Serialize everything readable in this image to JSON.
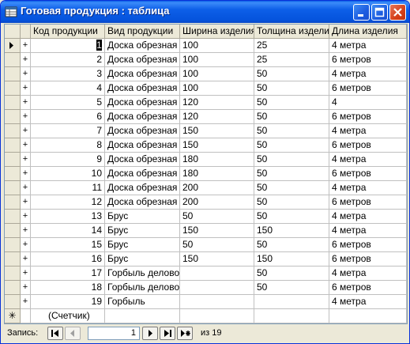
{
  "window": {
    "title": "Готовая продукция : таблица"
  },
  "columns": [
    "Код продукции",
    "Вид продукции",
    "Ширина изделия",
    "Толщина изделия",
    "Длина изделия"
  ],
  "rows": [
    {
      "id": "1",
      "type": "Доска обрезная",
      "width": "100",
      "thickness": "25",
      "length": "4 метра"
    },
    {
      "id": "2",
      "type": "Доска обрезная",
      "width": "100",
      "thickness": "25",
      "length": "6 метров"
    },
    {
      "id": "3",
      "type": "Доска обрезная",
      "width": "100",
      "thickness": "50",
      "length": "4 метра"
    },
    {
      "id": "4",
      "type": "Доска обрезная",
      "width": "100",
      "thickness": "50",
      "length": "6 метров"
    },
    {
      "id": "5",
      "type": "Доска обрезная",
      "width": "120",
      "thickness": "50",
      "length": "4"
    },
    {
      "id": "6",
      "type": "Доска обрезная",
      "width": "120",
      "thickness": "50",
      "length": "6 метров"
    },
    {
      "id": "7",
      "type": "Доска обрезная",
      "width": "150",
      "thickness": "50",
      "length": "4 метра"
    },
    {
      "id": "8",
      "type": "Доска обрезная",
      "width": "150",
      "thickness": "50",
      "length": "6 метров"
    },
    {
      "id": "9",
      "type": "Доска обрезная",
      "width": "180",
      "thickness": "50",
      "length": "4 метра"
    },
    {
      "id": "10",
      "type": "Доска обрезная",
      "width": "180",
      "thickness": "50",
      "length": "6 метров"
    },
    {
      "id": "11",
      "type": "Доска обрезная",
      "width": "200",
      "thickness": "50",
      "length": "4 метра"
    },
    {
      "id": "12",
      "type": "Доска обрезная",
      "width": "200",
      "thickness": "50",
      "length": "6 метров"
    },
    {
      "id": "13",
      "type": "Брус",
      "width": "50",
      "thickness": "50",
      "length": "4 метра"
    },
    {
      "id": "14",
      "type": "Брус",
      "width": "150",
      "thickness": "150",
      "length": "4 метра"
    },
    {
      "id": "15",
      "type": "Брус",
      "width": "50",
      "thickness": "50",
      "length": "6 метров"
    },
    {
      "id": "16",
      "type": "Брус",
      "width": "150",
      "thickness": "150",
      "length": "6 метров"
    },
    {
      "id": "17",
      "type": "Горбыль деловой",
      "width": "",
      "thickness": "50",
      "length": "4 метра"
    },
    {
      "id": "18",
      "type": "Горбыль деловой",
      "width": "",
      "thickness": "50",
      "length": "6 метров"
    },
    {
      "id": "19",
      "type": "Горбыль",
      "width": "",
      "thickness": "",
      "length": "4 метра"
    }
  ],
  "new_row": {
    "marker": "✳",
    "id_placeholder": "(Счетчик)"
  },
  "expand_symbol": "+",
  "navigation": {
    "label": "Запись:",
    "current": "1",
    "of_text": "из 19"
  }
}
